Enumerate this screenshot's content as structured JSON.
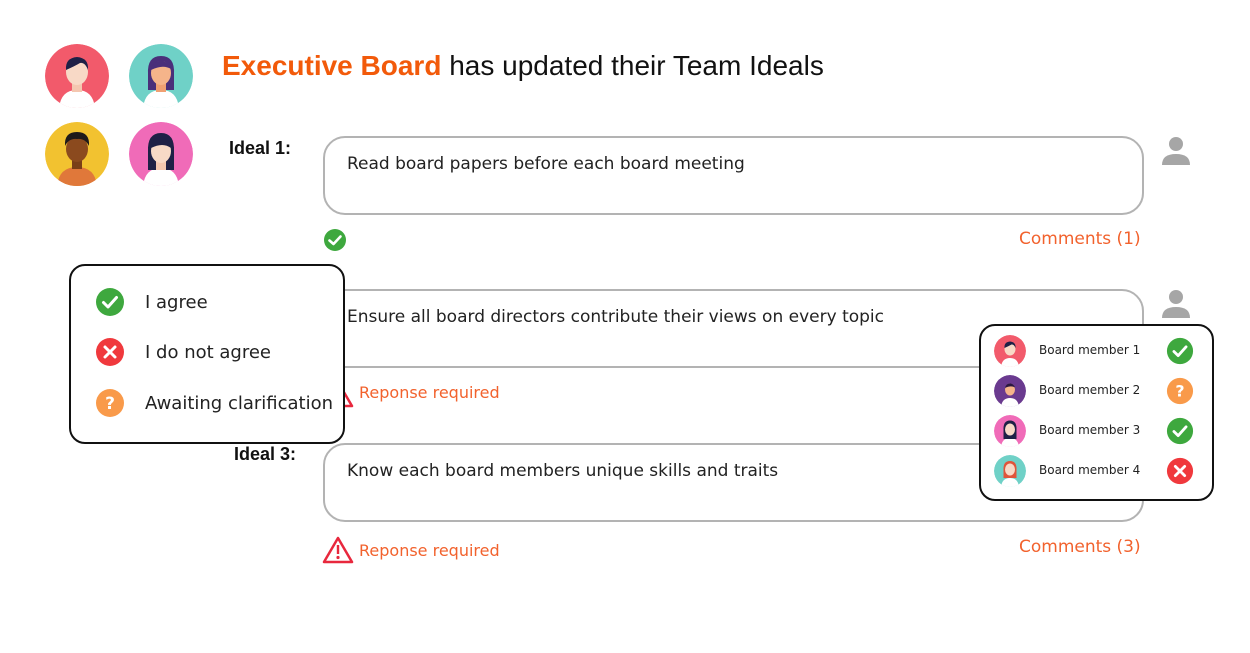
{
  "header": {
    "team_name": "Executive Board",
    "headline_rest": " has updated their Team Ideals"
  },
  "avatars": [
    {
      "name": "avatar-1",
      "bg": "#f25a6b"
    },
    {
      "name": "avatar-2",
      "bg": "#6fd1c7"
    },
    {
      "name": "avatar-3",
      "bg": "#f2c230"
    },
    {
      "name": "avatar-4",
      "bg": "#f06bb8"
    }
  ],
  "ideals": [
    {
      "label": "Ideal 1:",
      "text": "Read board papers before each board meeting",
      "status": "agree",
      "comments": "Comments (1)"
    },
    {
      "label": "",
      "text": "Ensure all board directors contribute their views on every topic",
      "response": "Reponse required"
    },
    {
      "label": "Ideal 3:",
      "text": "Know each board members unique skills and traits",
      "response": "Reponse required",
      "comments": "Comments (3)"
    }
  ],
  "legend": {
    "items": [
      {
        "label": "I agree",
        "icon": "check-circle-icon",
        "color": "#3ea83e"
      },
      {
        "label": "I do not agree",
        "icon": "x-circle-icon",
        "color": "#f0393d"
      },
      {
        "label": "Awaiting clarification",
        "icon": "question-circle-icon",
        "color": "#f99a4a"
      }
    ]
  },
  "members": [
    {
      "name": "Board member 1",
      "status": "agree"
    },
    {
      "name": "Board member 2",
      "status": "awaiting"
    },
    {
      "name": "Board member 3",
      "status": "agree"
    },
    {
      "name": "Board member 4",
      "status": "disagree"
    }
  ],
  "colors": {
    "accent": "#f25a0a",
    "link": "#f2622d",
    "agree": "#3ea83e",
    "disagree": "#f0393d",
    "awaiting": "#f99a4a",
    "border": "#b3b3b3",
    "user_icon": "#a6a6a6"
  }
}
